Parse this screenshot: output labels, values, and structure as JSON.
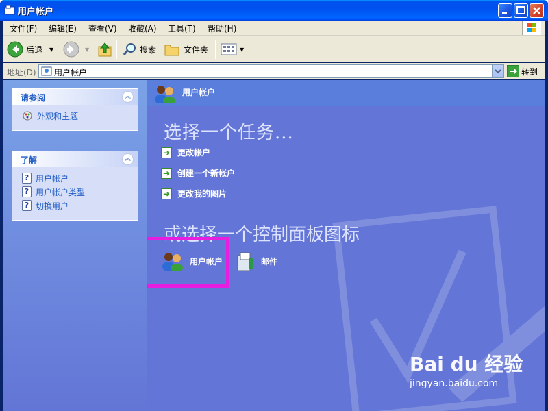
{
  "window": {
    "title": "用户帐户"
  },
  "menu": [
    "文件(F)",
    "编辑(E)",
    "查看(V)",
    "收藏(A)",
    "工具(T)",
    "帮助(H)"
  ],
  "toolbar": {
    "back": "后退",
    "search": "搜索",
    "folders": "文件夹"
  },
  "address": {
    "label": "地址(D)",
    "value": "用户帐户",
    "go": "转到"
  },
  "see_also": {
    "title": "请参阅",
    "links": [
      "外观和主题"
    ]
  },
  "learn": {
    "title": "了解",
    "links": [
      "用户帐户",
      "用户帐户类型",
      "切换用户"
    ]
  },
  "main": {
    "header": "用户帐户",
    "task_heading": "选择一个任务...",
    "tasks": [
      "更改帐户",
      "创建一个新帐户",
      "更改我的图片"
    ],
    "cp_heading": "或选择一个控制面板图标",
    "icons": [
      "用户帐户",
      "邮件"
    ]
  },
  "watermark": {
    "logo": "Bai du 经验",
    "url": "jingyan.baidu.com"
  },
  "colors": {
    "highlight": "#e81de0",
    "left_panel": "#7ba2e7",
    "right_panel": "#6375d6"
  }
}
